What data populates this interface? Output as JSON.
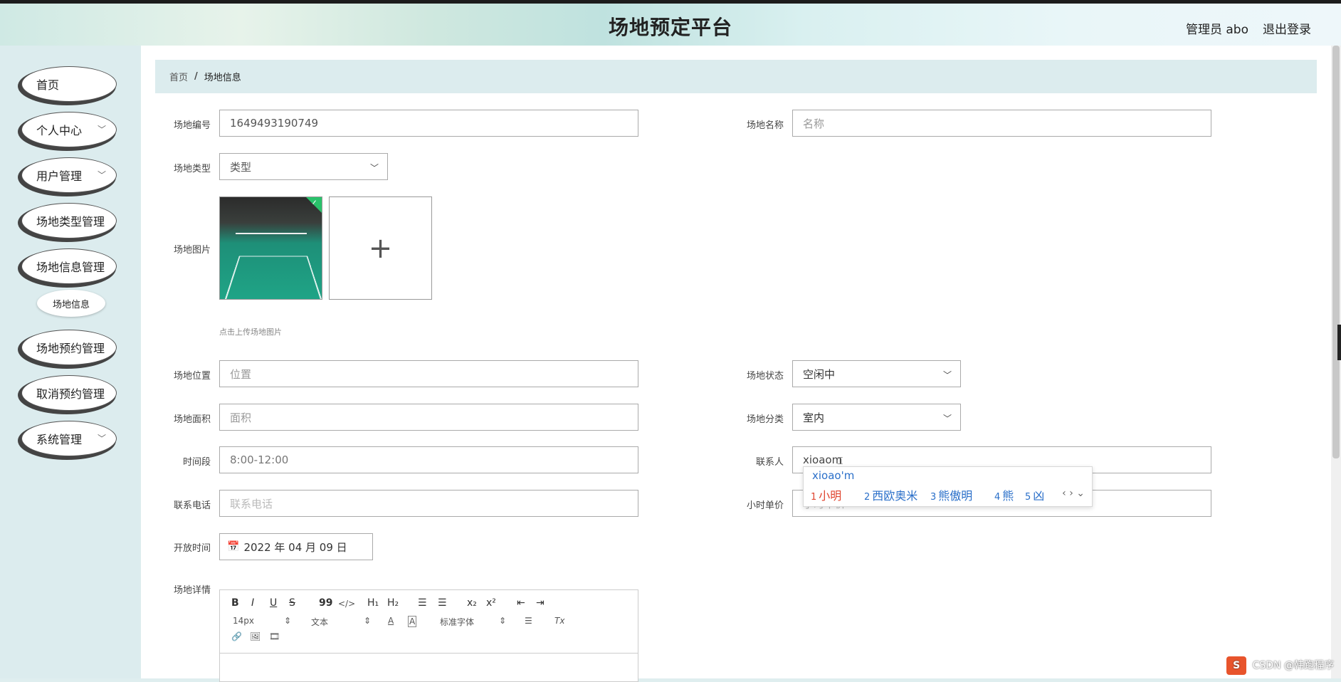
{
  "header": {
    "title": "场地预定平台",
    "admin": "管理员 abo",
    "logout": "退出登录"
  },
  "sidebar": {
    "items": [
      {
        "label": "首页",
        "chev": ""
      },
      {
        "label": "个人中心",
        "chev": "﹀"
      },
      {
        "label": "用户管理",
        "chev": "﹀"
      },
      {
        "label": "场地类型管理",
        "chev": ""
      },
      {
        "label": "场地信息管理",
        "chev": ""
      },
      {
        "label": "场地预约管理",
        "chev": ""
      },
      {
        "label": "取消预约管理",
        "chev": ""
      },
      {
        "label": "系统管理",
        "chev": "﹀"
      }
    ],
    "sub": "场地信息"
  },
  "breadcrumb": {
    "home": "首页",
    "sep": "/",
    "current": "场地信息"
  },
  "form": {
    "code": {
      "label": "场地编号",
      "value": "1649493190749"
    },
    "name": {
      "label": "场地名称",
      "placeholder": "名称"
    },
    "type": {
      "label": "场地类型",
      "value": "类型"
    },
    "image": {
      "label": "场地图片",
      "plus": "+",
      "check": "✓",
      "hint": "点击上传场地图片"
    },
    "location": {
      "label": "场地位置",
      "placeholder": "位置"
    },
    "status": {
      "label": "场地状态",
      "value": "空闲中"
    },
    "area": {
      "label": "场地面积",
      "placeholder": "面积"
    },
    "category": {
      "label": "场地分类",
      "value": "室内"
    },
    "timeslot": {
      "label": "时间段",
      "value": "8:00-12:00"
    },
    "contact": {
      "label": "联系人",
      "value": "xioaom"
    },
    "phone": {
      "label": "联系电话",
      "placeholder": "联系电话"
    },
    "price": {
      "label": "小时单价",
      "placeholder": "小时单价"
    },
    "opentime": {
      "label": "开放时间",
      "value": "2022 年 04 月 09 日",
      "icon": "📅"
    },
    "detail": {
      "label": "场地详情"
    }
  },
  "editor": {
    "bold": "B",
    "italic": "I",
    "underline": "U",
    "strike": "S",
    "quote": "99",
    "code": "</>",
    "h1": "H₁",
    "h2": "H₂",
    "olist": "☰",
    "ulist": "☰",
    "sub": "x₂",
    "sup": "x²",
    "outdent": "⇤",
    "indent": "⇥",
    "size": "14px",
    "size_arrow": "⇕",
    "text": "文本",
    "text_arrow": "⇕",
    "color": "A",
    "bg": "A",
    "font": "标准字体",
    "font_arrow": "⇕",
    "align": "☰",
    "clear": "Tx",
    "link": "🔗",
    "image": "🖼",
    "video": "🎞"
  },
  "ime": {
    "composition": "xioao'm",
    "candidates": [
      {
        "num": "1",
        "text": "小明"
      },
      {
        "num": "2",
        "text": "西欧奥米"
      },
      {
        "num": "3",
        "text": "熊傲明"
      },
      {
        "num": "4",
        "text": "熊"
      },
      {
        "num": "5",
        "text": "凶"
      }
    ],
    "nav": "‹ › ⌄"
  },
  "watermark": {
    "logo": "S",
    "text": "CSDN @韩跑程序"
  }
}
